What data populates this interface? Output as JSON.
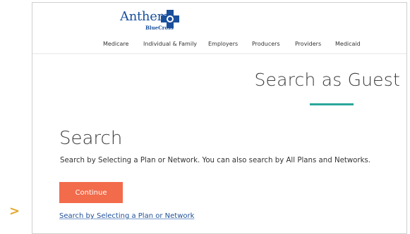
{
  "pointer": ">",
  "header": {
    "logo": {
      "name": "Anthem",
      "sub": "BlueCross",
      "icon": "blue-cross-icon"
    },
    "nav": [
      "Medicare",
      "Individual & Family",
      "Employers",
      "Producers",
      "Providers",
      "Medicaid"
    ]
  },
  "main": {
    "page_title": "Search as Guest",
    "search_heading": "Search",
    "search_description": "Search by Selecting a Plan or Network. You can also search by All Plans and Networks.",
    "continue_label": "Continue",
    "plan_link": "Search by Selecting a Plan or Network"
  },
  "colors": {
    "brand_blue": "#1a4f9c",
    "accent_teal": "#2aa89a",
    "button_orange": "#f26b4b",
    "pointer_gold": "#e3a82b"
  }
}
